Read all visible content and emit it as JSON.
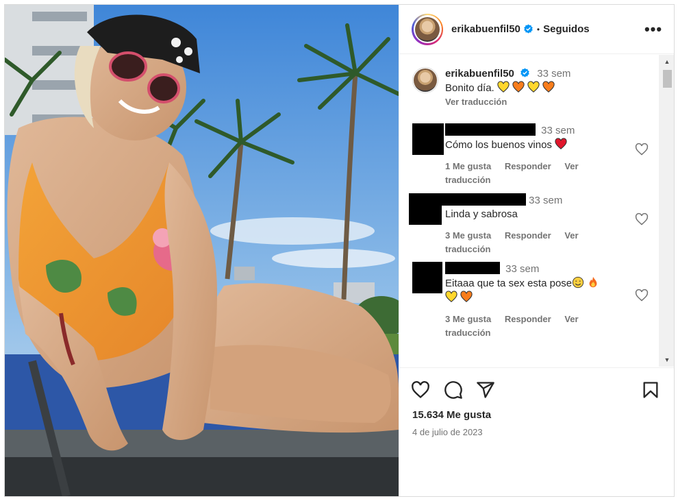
{
  "post": {
    "username": "erikabuenfil50",
    "separator": "•",
    "follow_status": "Seguidos",
    "more_icon": "more-horizontal-icon"
  },
  "caption": {
    "username": "erikabuenfil50",
    "time": "33 sem",
    "text": "Bonito día.",
    "emojis": [
      "yellow-heart",
      "orange-heart",
      "yellow-heart",
      "orange-heart"
    ],
    "translate": "Ver traducción"
  },
  "comments": [
    {
      "time": "33 sem",
      "text": "Cómo los buenos vinos",
      "emoji": "red-heart",
      "likes": "1 Me gusta",
      "reply": "Responder",
      "translate": "Ver traducción"
    },
    {
      "time": "33 sem",
      "text": "Linda y sabrosa",
      "likes": "3 Me gusta",
      "reply": "Responder",
      "translate": "Ver traducción"
    },
    {
      "time": "33 sem",
      "text": "Eitaaa que ta sex esta pose",
      "emojis": [
        "smiling-face",
        "fire",
        "yellow-heart",
        "orange-heart"
      ],
      "likes": "3 Me gusta",
      "reply": "Responder",
      "translate": "Ver traducción"
    }
  ],
  "footer": {
    "likes": "15.634 Me gusta",
    "date": "4 de julio de 2023"
  },
  "colors": {
    "text": "#262626",
    "muted": "#737373",
    "verified": "#0095f6",
    "border": "#dbdbdb"
  }
}
